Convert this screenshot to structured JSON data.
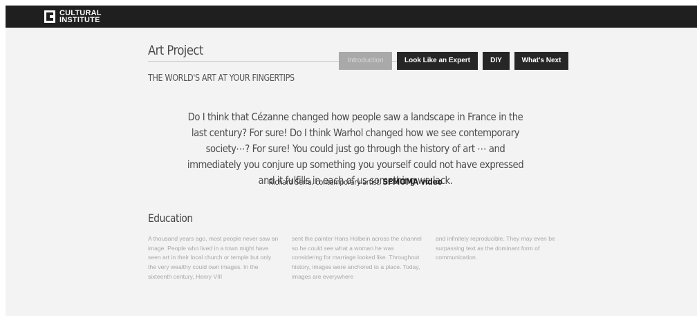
{
  "header": {
    "logo_line1": "CULTURAL",
    "logo_line2": "INSTITUTE",
    "logo_icon": "cultural-institute-logo-icon"
  },
  "page": {
    "title": "Art Project",
    "subtitle": "THE WORLD'S ART AT YOUR FINGERTIPS"
  },
  "nav": {
    "items": [
      {
        "label": "Introduction",
        "active": false
      },
      {
        "label": "Look Like an Expert",
        "active": true
      },
      {
        "label": "DIY",
        "active": true
      },
      {
        "label": "What's Next",
        "active": true
      }
    ]
  },
  "quote": {
    "text": "Do I think that Cézanne changed how people saw a landscape in France in the last century? For sure! Do I think Warhol changed how we see contemporary society⋯? For sure! You could just go through the history of art ⋯ and immediately you conjure up something you yourself could not have expressed and it fulfills in each of us something we lack.",
    "attribution": "Richard Serra, contemporary artist,",
    "source_link": "SFMOMA video"
  },
  "education": {
    "heading": "Education",
    "columns": [
      "A thousand years ago, most people never saw an image. People who lived in a town might have seen art in their local church or temple but only the very wealthy could own images. In the sixteenth century, Henry VIII",
      "sent the painter Hans Holbein across the channel so he could see what a woman he was considering for marriage looked like. Throughout history, images were anchored to a place. Today, images are everywhere",
      "and infinitely reproducible. They may even be surpassing text as the dominant form of communication."
    ]
  },
  "colors": {
    "topbar": "#1f1f1f",
    "background": "#f3f3f3",
    "button": "#262626",
    "button_inactive": "#a9a9a9",
    "body_text": "#a8a8a8"
  }
}
